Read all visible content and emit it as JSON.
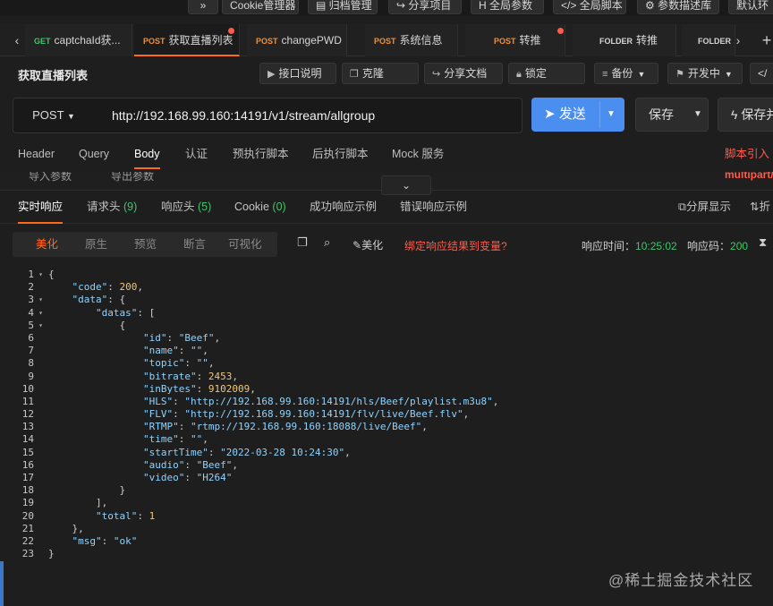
{
  "topbar": {
    "buttons": [
      "»",
      "Cookie管理器",
      "归档管理",
      "分享项目",
      "全局参数",
      "全局脚本",
      "参数描述库",
      "默认环"
    ]
  },
  "tabs": {
    "items": [
      {
        "method": "GET",
        "label": "captchaId获..."
      },
      {
        "method": "POST",
        "label": "获取直播列表"
      },
      {
        "method": "POST",
        "label": "changePWD"
      },
      {
        "method": "POST",
        "label": "系统信息"
      },
      {
        "method": "POST",
        "label": "转推"
      },
      {
        "method": "FOLDER",
        "label": "转推"
      },
      {
        "method": "FOLDER",
        "label": ""
      }
    ],
    "prev": "‹",
    "next": "›",
    "add": "+"
  },
  "actions": {
    "title": "获取直播列表",
    "api_doc": "接口说明",
    "clone": "克隆",
    "share_doc": "分享文档",
    "lock": "锁定",
    "backup": "备份",
    "status": "开发中"
  },
  "request": {
    "method": "POST",
    "url": "http://192.168.99.160:14191/v1/stream/allgroup",
    "send": "发送",
    "save": "保存",
    "save_as": "保存并"
  },
  "req_tabs": [
    "Header",
    "Query",
    "Body",
    "认证",
    "预执行脚本",
    "后执行脚本",
    "Mock 服务"
  ],
  "req_right": "脚本引入",
  "strip": {
    "left1": "导入参数",
    "left2": "导出参数",
    "right": "multipart/"
  },
  "resp_tabs": [
    {
      "label": "实时响应",
      "count": ""
    },
    {
      "label": "请求头",
      "count": "(9)"
    },
    {
      "label": "响应头",
      "count": "(5)"
    },
    {
      "label": "Cookie",
      "count": "(0)"
    },
    {
      "label": "成功响应示例",
      "count": ""
    },
    {
      "label": "错误响应示例",
      "count": ""
    }
  ],
  "resp_right": {
    "split": "分屏显示",
    "fold": "折"
  },
  "view": {
    "modes": [
      "美化",
      "原生",
      "预览",
      "断言",
      "可视化"
    ],
    "beautify": "美化",
    "bind": "绑定响应结果到变量?",
    "resp_time_label": "响应时间：",
    "resp_time": "10:25:02",
    "resp_code_label": "响应码：",
    "resp_code": "200"
  },
  "code": {
    "code_val": "200",
    "id": "\"Beef\"",
    "name": "\"\"",
    "topic": "\"\"",
    "bitrate": "2453",
    "inBytes": "9102009",
    "HLS": "\"http://192.168.99.160:14191/hls/Beef/playlist.m3u8\"",
    "FLV": "\"http://192.168.99.160:14191/flv/live/Beef.flv\"",
    "RTMP": "\"rtmp://192.168.99.160:18088/live/Beef\"",
    "time": "\"\"",
    "startTime": "\"2022-03-28 10:24:30\"",
    "audio": "\"Beef\"",
    "video": "\"H264\"",
    "total": "1",
    "msg": "\"ok\""
  },
  "watermark": "@稀土掘金技术社区"
}
